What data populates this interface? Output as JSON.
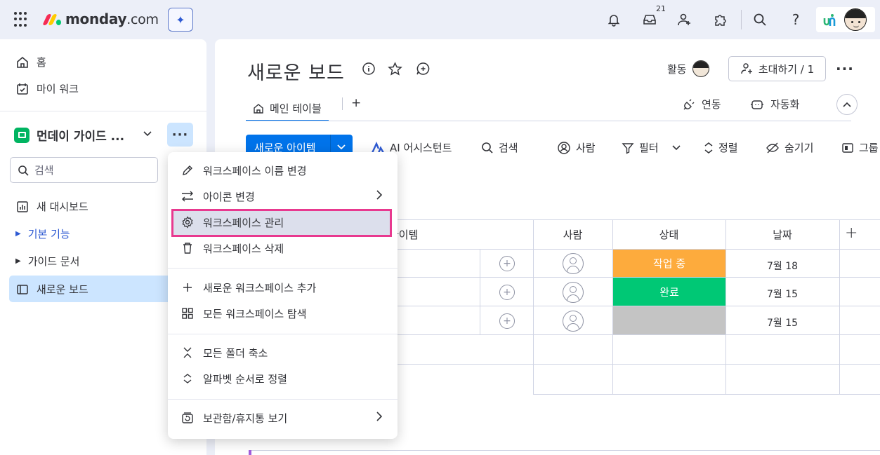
{
  "topbar": {
    "brand_name": "monday",
    "brand_suffix": ".com",
    "ai_label": "✦",
    "inbox_badge": "21",
    "logo_colors": [
      "#f62b54",
      "#ffcb00",
      "#00ca72"
    ]
  },
  "sidebar": {
    "home": "홈",
    "my_work": "마이 워크",
    "workspace_name": "먼데이 가이드 ...",
    "search_placeholder": "검색",
    "items": [
      {
        "label": "새 대시보드"
      },
      {
        "label": "기본 기능"
      },
      {
        "label": "가이드 문서"
      },
      {
        "label": "새로운 보드"
      }
    ]
  },
  "board": {
    "title": "새로운 보드",
    "activity_label": "활동",
    "invite_label": "초대하기 / 1",
    "tab_main": "메인 테이블",
    "tab_add": "+",
    "integrate_label": "연동",
    "automate_label": "자동화"
  },
  "toolbar": {
    "new_item": "새로운 아이템",
    "ai_assistant": "AI 어시스턴트",
    "search": "검색",
    "person": "사람",
    "filter": "필터",
    "sort": "정렬",
    "hide": "숨기기",
    "group": "그룹"
  },
  "table": {
    "headers": {
      "item": "아이템",
      "person": "사람",
      "status": "상태",
      "date": "날짜",
      "add": "+"
    },
    "rows": [
      {
        "status": "작업 중",
        "status_color": "#fdab3d",
        "date": "7월 18"
      },
      {
        "status": "완료",
        "status_color": "#00c875",
        "date": "7월 15"
      },
      {
        "status": "",
        "status_color": "#c4c4c4",
        "date": "7월 15"
      }
    ]
  },
  "menu": {
    "items": [
      {
        "label": "워크스페이스 이름 변경",
        "icon": "pencil-icon"
      },
      {
        "label": "아이콘 변경",
        "icon": "swap-icon"
      },
      {
        "label": "워크스페이스 관리",
        "icon": "gear-icon"
      },
      {
        "label": "워크스페이스 삭제",
        "icon": "trash-icon"
      },
      {
        "label": "새로운 워크스페이스 추가",
        "icon": "plus-icon"
      },
      {
        "label": "모든 워크스페이스 탐색",
        "icon": "grid-icon"
      },
      {
        "label": "모든 폴더 축소",
        "icon": "collapse-icon"
      },
      {
        "label": "알파벳 순서로 정렬",
        "icon": "sort-icon"
      },
      {
        "label": "보관함/휴지통 보기",
        "icon": "archive-icon"
      }
    ],
    "highlight_color": "#e8398f"
  }
}
